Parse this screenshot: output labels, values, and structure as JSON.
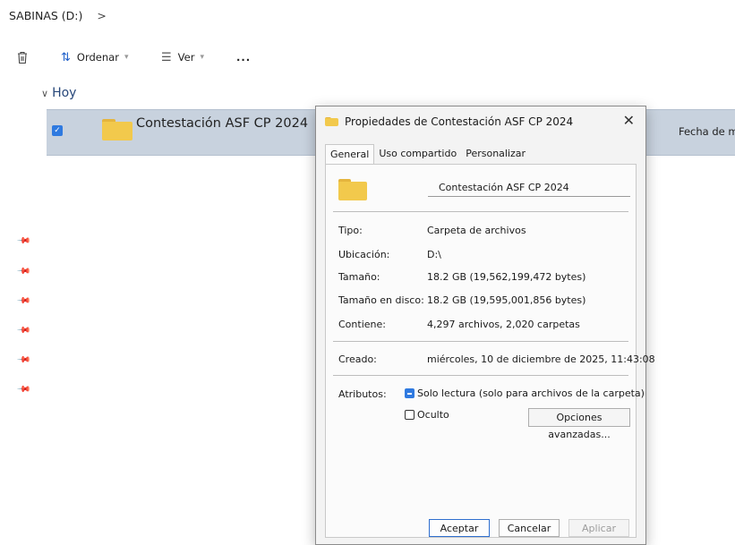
{
  "explorer": {
    "breadcrumb": "SABINAS (D:)",
    "breadcrumb_chevron": ">",
    "toolbar": {
      "sort_label": "Ordenar",
      "view_label": "Ver",
      "more_label": "..."
    },
    "group_label": "Hoy",
    "file_row": {
      "name": "Contestación ASF CP 2024",
      "column_header_partial": "Fecha de mo"
    }
  },
  "dialog": {
    "title": "Propiedades de Contestación ASF CP 2024",
    "tabs": [
      {
        "label": "General",
        "active": true
      },
      {
        "label": "Uso compartido",
        "active": false
      },
      {
        "label": "Personalizar",
        "active": false
      }
    ],
    "folder_name": "Contestación ASF CP 2024",
    "properties": {
      "type_label": "Tipo:",
      "type_value": "Carpeta de archivos",
      "location_label": "Ubicación:",
      "location_value": "D:\\",
      "size_label": "Tamaño:",
      "size_value": "18.2 GB (19,562,199,472 bytes)",
      "disk_size_label": "Tamaño en disco:",
      "disk_size_value": "18.2 GB (19,595,001,856 bytes)",
      "contains_label": "Contiene:",
      "contains_value": "4,297 archivos, 2,020 carpetas",
      "created_label": "Creado:",
      "created_value": "miércoles, 10 de diciembre de 2025, 11:43:08",
      "attributes_label": "Atributos:",
      "readonly_label": "Solo lectura (solo para archivos de la carpeta)",
      "readonly_state": "indeterminate",
      "hidden_label": "Oculto",
      "hidden_state": "unchecked",
      "advanced_button": "Opciones avanzadas..."
    },
    "buttons": {
      "ok": "Aceptar",
      "cancel": "Cancelar",
      "apply": "Aplicar"
    }
  },
  "colors": {
    "selection_row": "#c8d2de",
    "accent": "#2f7ae0",
    "folder": "#f2c94c"
  }
}
